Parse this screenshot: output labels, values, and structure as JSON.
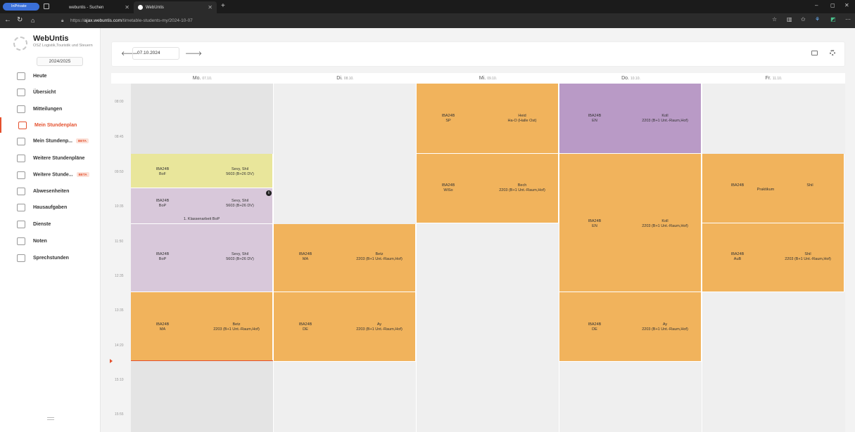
{
  "browser": {
    "private_label": "InPrivate",
    "tabs": [
      {
        "title": "webuntis - Suchen"
      },
      {
        "title": "WebUntis"
      }
    ],
    "url_prefix": "https://",
    "url_host": "ajax.webuntis.com",
    "url_path": "/timetable-students-my/2024-10-07"
  },
  "sidebar": {
    "brand": "WebUntis",
    "school": "OSZ Logistik,Touristik und Steuern",
    "year": "2024/2025",
    "items": [
      {
        "label": "Heute",
        "icon": "grid-icon",
        "beta": ""
      },
      {
        "label": "Übersicht",
        "icon": "overview-icon",
        "beta": ""
      },
      {
        "label": "Mitteilungen",
        "icon": "mail-icon",
        "beta": ""
      },
      {
        "label": "Mein Stundenplan",
        "icon": "calendar-user-icon",
        "beta": ""
      },
      {
        "label": "Mein Stundenp...",
        "icon": "calendar-user-icon",
        "beta": "BETA"
      },
      {
        "label": "Weitere Stundenpläne",
        "icon": "calendar-icon",
        "beta": ""
      },
      {
        "label": "Weitere Stunde...",
        "icon": "calendar-icon",
        "beta": "BETA"
      },
      {
        "label": "Abwesenheiten",
        "icon": "absence-icon",
        "beta": ""
      },
      {
        "label": "Hausaufgaben",
        "icon": "homework-icon",
        "beta": ""
      },
      {
        "label": "Dienste",
        "icon": "duty-icon",
        "beta": ""
      },
      {
        "label": "Noten",
        "icon": "grades-icon",
        "beta": ""
      },
      {
        "label": "Sprechstunden",
        "icon": "consultation-icon",
        "beta": ""
      }
    ]
  },
  "toolbar": {
    "date": "07.10.2024",
    "prev_glyph": "🡐",
    "next_glyph": "🡒"
  },
  "days": [
    {
      "name": "Mo.",
      "date": "07.10."
    },
    {
      "name": "Di.",
      "date": "08.10."
    },
    {
      "name": "Mi.",
      "date": "09.10."
    },
    {
      "name": "Do.",
      "date": "10.10."
    },
    {
      "name": "Fr.",
      "date": "11.10."
    }
  ],
  "times": [
    "08:00",
    "08:45",
    "09:50",
    "10:35",
    "11:50",
    "12:35",
    "13:35",
    "14:20",
    "15:10",
    "15:55"
  ],
  "lessons": {
    "mo1": {
      "class": "IBA24B",
      "subject": "BoF",
      "teacher": "Sevy, Shil",
      "room": "5603 (B+26 DV)"
    },
    "mo2": {
      "class": "IBA24B",
      "subject": "BoP",
      "teacher": "Sevy, Shil",
      "room": "5603 (B+26 DV)",
      "note": "1. Klassenarbeit BoP"
    },
    "mo3": {
      "class": "IBA24B",
      "subject": "BoP",
      "teacher": "Sevy, Shil",
      "room": "5603 (B+26 DV)"
    },
    "mo4": {
      "class": "IBA24B",
      "subject": "MA",
      "teacher": "Betz",
      "room": "2203 (B+1 Unt.-Raum,Hof)"
    },
    "di1": {
      "class": "IBA24B",
      "subject": "MA",
      "teacher": "Betz",
      "room": "2203 (B+1 Unt.-Raum,Hof)"
    },
    "di2": {
      "class": "IBA24B",
      "subject": "DE",
      "teacher": "Ay",
      "room": "2203 (B+1 Unt.-Raum,Hof)"
    },
    "mi1": {
      "class": "IBA24B",
      "subject": "SP",
      "teacher": "Heid",
      "room": "Ha-O (Halle Ost)"
    },
    "mi2": {
      "class": "IBA24B",
      "subject": "WiSo",
      "teacher": "Bech",
      "room": "2203 (B+1 Unt.-Raum,Hof)"
    },
    "do1": {
      "class": "IBA24B",
      "subject": "EN",
      "teacher": "Koll",
      "room": "2203 (B+1 Unt.-Raum,Hof)"
    },
    "do2": {
      "class": "IBA24B",
      "subject": "EN",
      "teacher": "Koll",
      "room": "2203 (B+1 Unt.-Raum,Hof)"
    },
    "do3": {
      "class": "IBA24B",
      "subject": "DE",
      "teacher": "Ay",
      "room": "2203 (B+1 Unt.-Raum,Hof)"
    },
    "fr1": {
      "class": "IBA24B",
      "subject": "Praktikum",
      "teacher": "Shil",
      "room": ""
    },
    "fr2": {
      "class": "IBA24B",
      "subject": "AuB",
      "teacher": "Shil",
      "room": "2203 (B+1 Unt.-Raum,Hof)"
    }
  },
  "colors": {
    "accent": "#e4502d",
    "lesson_orange": "#f1b35c",
    "lesson_purple": "#b99ac6",
    "exam_yellow": "#e9e69b",
    "exam_lilac": "#d8c8da"
  }
}
